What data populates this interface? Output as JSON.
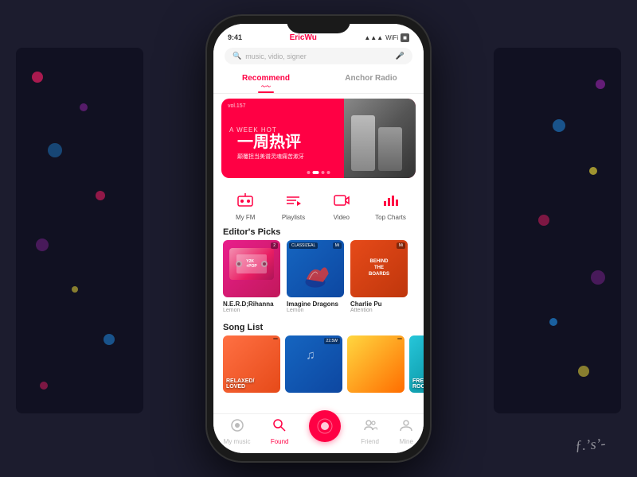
{
  "app": {
    "name": "EricWu",
    "status_time": "9:41",
    "status_signal": "▲▲▲",
    "status_wifi": "WiFi",
    "status_battery": "🔋"
  },
  "search": {
    "placeholder": "music, vidio, signer"
  },
  "tabs": {
    "recommend": "Recommend",
    "anchor_radio": "Anchor Radio"
  },
  "banner": {
    "vol": "vol.157",
    "title_zh": "一周热评",
    "subtitle_zh": "颠覆担当美谱灵魂痛苦漱牙",
    "tag": "A WEEK HOT"
  },
  "quick": {
    "items": [
      {
        "icon": "📻",
        "label": "My FM"
      },
      {
        "icon": "🎵",
        "label": "Playlists"
      },
      {
        "icon": "🎬",
        "label": "Video"
      },
      {
        "icon": "📊",
        "label": "Top Charts"
      }
    ]
  },
  "editors_picks": {
    "title": "Editor's Picks",
    "items": [
      {
        "tag": "Y2K+POP",
        "plays": "2",
        "title": "N.E.R.D;Rihanna",
        "sub": "Lemon",
        "style": "cover-yk"
      },
      {
        "tag": "CLASSICAL",
        "plays": "Mi",
        "title": "Imagine Dragons",
        "sub": "Lemon",
        "style": "cover-classical"
      },
      {
        "tag": "",
        "plays": "Mi",
        "title": "Charlie Pu",
        "sub": "Attention",
        "style": "cover-behind"
      }
    ]
  },
  "song_list": {
    "title": "Song List",
    "items": [
      {
        "plays": "RELAXED/LOVED",
        "style": "song-card-1"
      },
      {
        "plays": "22.5W",
        "style": "song-card-2"
      },
      {
        "plays": "",
        "style": "song-card-3"
      },
      {
        "plays": "FREEZING ROCK",
        "style": "song-card-4"
      }
    ]
  },
  "bottom_nav": {
    "items": [
      {
        "icon": "♪",
        "label": "My music",
        "active": false
      },
      {
        "icon": "🔍",
        "label": "Found",
        "active": true
      },
      {
        "icon": "▶",
        "label": "",
        "active": false,
        "center": true
      },
      {
        "icon": "👥",
        "label": "Friend",
        "active": false
      },
      {
        "icon": "👤",
        "label": "Mine",
        "active": false
      }
    ]
  },
  "signature": "ƒ.ʼsʼ-"
}
